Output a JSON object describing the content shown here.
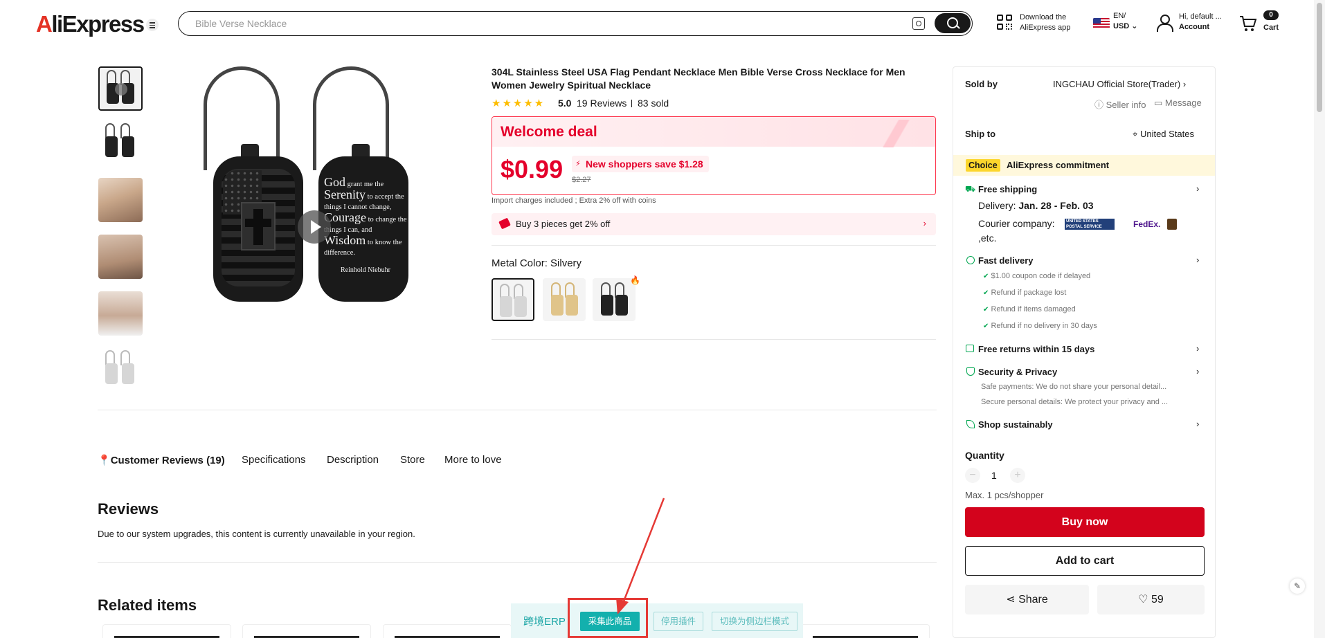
{
  "header": {
    "logo_prefix": "A",
    "logo_rest": "liExpress",
    "search_placeholder": "Bible Verse Necklace",
    "app_line1": "Download the",
    "app_line2": "AliExpress app",
    "lang_line1": "EN/",
    "lang_line2": "USD",
    "account_line1": "Hi, default ...",
    "account_line2": "Account",
    "cart_count": "0",
    "cart_label": "Cart"
  },
  "gallery": {
    "verse_god": "God",
    "verse_1": " grant me the",
    "verse_serenity": "Serenity",
    "verse_2": " to accept the things I cannot change,",
    "verse_courage": "Courage",
    "verse_3": " to change the things I can, and",
    "verse_wisdom": "Wisdom",
    "verse_4": " to know the difference.",
    "verse_author": "Reinhold Niebuhr"
  },
  "product": {
    "title": "304L Stainless Steel USA Flag Pendant Necklace Men Bible Verse Cross Necklace for Men Women Jewelry Spiritual Necklace",
    "stars": "★★★★★",
    "rating": "5.0",
    "reviews": "19 Reviews",
    "sold": "83 sold",
    "deal_title": "Welcome deal",
    "price": "$0.99",
    "save_text": "New shoppers save $1.28",
    "old_price": "$2.27",
    "import_note": "Import charges included ; Extra 2% off with coins",
    "promo_text": "Buy 3 pieces get 2% off",
    "color_label": "Metal Color: Silvery"
  },
  "panel": {
    "sold_by_label": "Sold by",
    "store_name": "INGCHAU Official Store(Trader)",
    "seller_info": "Seller info",
    "message": "Message",
    "ship_to_label": "Ship to",
    "ship_to_value": "United States",
    "choice_badge": "Choice",
    "choice_text": "AliExpress commitment",
    "free_shipping": "Free shipping",
    "delivery_label": "Delivery: ",
    "delivery_dates": "Jan. 28 - Feb. 03",
    "courier_label": "Courier company:",
    "carrier_usps": "UNITED STATES POSTAL SERVICE",
    "carrier_fedex": "FedEx.",
    "etc": ",etc.",
    "fast_delivery": "Fast delivery",
    "fast_items": [
      "$1.00 coupon code if delayed",
      "Refund if package lost",
      "Refund if items damaged",
      "Refund if no delivery in 30 days"
    ],
    "free_returns": "Free returns within 15 days",
    "security": "Security & Privacy",
    "security_1": "Safe payments: We do not share your personal detail...",
    "security_2": "Secure personal details: We protect your privacy and ...",
    "sustainably": "Shop sustainably",
    "quantity_label": "Quantity",
    "quantity_minus": "−",
    "quantity_value": "1",
    "quantity_plus": "+",
    "max_note": "Max. 1 pcs/shopper",
    "buy_now": "Buy now",
    "add_to_cart": "Add to cart",
    "share": "Share",
    "likes": "59"
  },
  "tabs": [
    "Customer Reviews (19)",
    "Specifications",
    "Description",
    "Store",
    "More to love"
  ],
  "reviews_section": {
    "heading": "Reviews",
    "note": "Due to our system upgrades, this content is currently unavailable in your region."
  },
  "related": {
    "heading": "Related items"
  },
  "erp": {
    "title": "跨境ERP",
    "collect": "采集此商品",
    "disable": "停用插件",
    "sidebar_mode": "切换为侧边栏模式"
  },
  "colors": {
    "brand_red": "#e4002b",
    "buy_red": "#d3031c",
    "erp_teal": "#13b0ad",
    "choice_yellow": "#fcd62c",
    "annotation_red": "#e53935"
  },
  "icons": {
    "menu": "hamburger-icon",
    "camera": "image-search-icon",
    "search": "search-icon",
    "qr": "qr-code-icon",
    "user": "user-icon",
    "cart": "cart-icon",
    "play": "play-icon",
    "share": "share-icon",
    "heart": "heart-icon",
    "location": "location-pin-icon",
    "edit": "edit-icon"
  }
}
